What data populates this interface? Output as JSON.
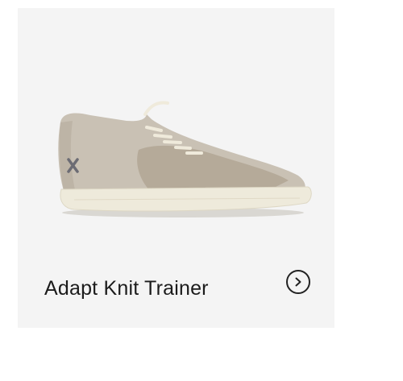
{
  "product": {
    "name": "Adapt Knit Trainer",
    "image_alt": "beige knit sneaker",
    "colors": {
      "card_background": "#f4f4f4",
      "upper": "#c7bfb2",
      "sole": "#efebdc",
      "text": "#1b1b1b"
    }
  },
  "actions": {
    "arrow_icon": "chevron-right-icon"
  }
}
